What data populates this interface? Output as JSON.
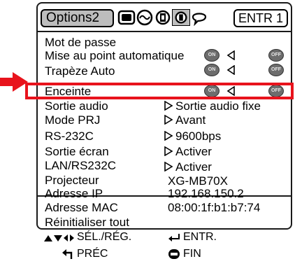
{
  "header": {
    "tab_title": "Options2",
    "entr_label": "ENTR 1",
    "icons": [
      "picture-tab-icon",
      "sync-tab-icon",
      "settings-tab-icon",
      "options2-tab-icon",
      "language-tab-icon"
    ]
  },
  "rows": [
    {
      "label": "Mot de passe"
    },
    {
      "label": "Mise au point automatique",
      "value": "ON / OFF"
    },
    {
      "label": "Trapèze Auto",
      "value": "ON / OFF"
    },
    {
      "label": "Enceinte",
      "value": "ON / OFF"
    },
    {
      "label": "Sortie audio",
      "value": "Sortie audio fixe"
    },
    {
      "label": "Mode PRJ",
      "value": "Avant"
    },
    {
      "label": "RS-232C",
      "value": "9600bps"
    },
    {
      "label": "Sortie écran",
      "value": "Activer"
    },
    {
      "label": "LAN/RS232C",
      "value": "Activer"
    },
    {
      "label": "Projecteur",
      "value": "XG-MB70X"
    },
    {
      "label": "Adresse IP",
      "value": "192.168.150.2"
    },
    {
      "label": "Adresse MAC",
      "value": "08:00:1f:b1:b7:74"
    },
    {
      "label": "Réinitialiser tout"
    }
  ],
  "toggle": {
    "on": "ON",
    "off": "OFF"
  },
  "footer": {
    "select_adjust": "SÉL./RÉG.",
    "enter": "ENTR.",
    "previous": "PRÉC",
    "end": "FIN"
  },
  "colors": {
    "highlight": "#e8131c",
    "tab_fill": "#bdbdbd"
  }
}
